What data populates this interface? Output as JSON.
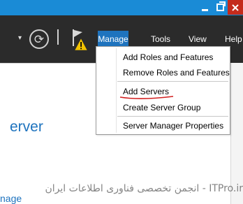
{
  "header": {
    "menu": [
      {
        "label": "Manage",
        "active": true
      },
      {
        "label": "Tools",
        "active": false
      },
      {
        "label": "View",
        "active": false
      },
      {
        "label": "Help",
        "active": false
      }
    ],
    "icons": {
      "dropdown": "chevron-down-icon",
      "refresh": "refresh-icon",
      "notifications": "flag-warning-icon"
    }
  },
  "manage_menu": {
    "items": [
      "Add Roles and Features",
      "Remove Roles and Features",
      "Add Servers",
      "Create Server Group",
      "Server Manager Properties"
    ]
  },
  "content": {
    "title_fragment": "erver",
    "link_fragment": "nage"
  },
  "watermark": {
    "text": "ITPro.ir - انجمن تخصصی فناوری اطلاعات ایران"
  },
  "colors": {
    "titlebar": "#1a8bd6",
    "header": "#2b2b2b",
    "accent": "#1e73be",
    "close": "#c42b1c"
  }
}
